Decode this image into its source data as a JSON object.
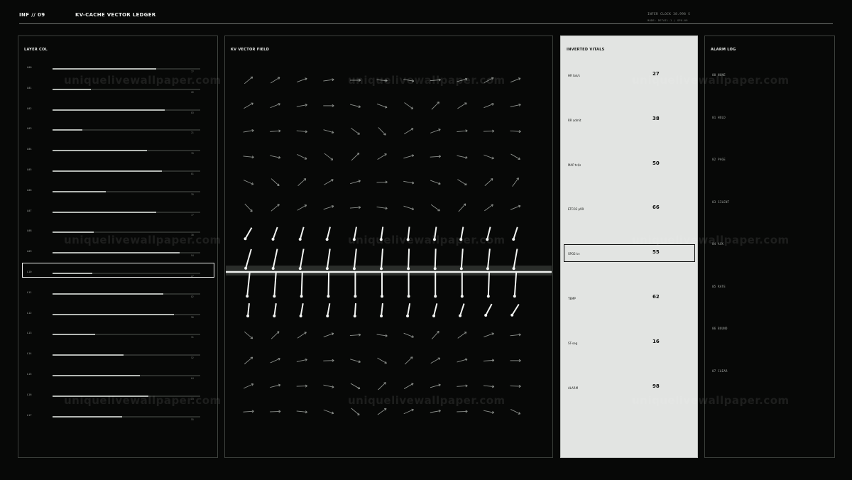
{
  "header": {
    "id": "INF // 09",
    "title": "KV-CACHE VECTOR LEDGER",
    "clock": "INFER CLOCK 38.998 S",
    "mode": "MODE: DETAIL-1 / GPU-09"
  },
  "layer_panel": {
    "title": "LAYER COL",
    "selected_index": 10,
    "rows": [
      {
        "name": "L00",
        "value": "77",
        "fill": 0.7
      },
      {
        "name": "L01",
        "value": "26",
        "fill": 0.26
      },
      {
        "name": "L02",
        "value": "83",
        "fill": 0.76
      },
      {
        "name": "L03",
        "value": "21",
        "fill": 0.2
      },
      {
        "name": "L04",
        "value": "70",
        "fill": 0.64
      },
      {
        "name": "L05",
        "value": "81",
        "fill": 0.74
      },
      {
        "name": "L06",
        "value": "39",
        "fill": 0.36
      },
      {
        "name": "L07",
        "value": "77",
        "fill": 0.7
      },
      {
        "name": "L08",
        "value": "30",
        "fill": 0.28
      },
      {
        "name": "L09",
        "value": "94",
        "fill": 0.86
      },
      {
        "name": "L10",
        "value": "27",
        "fill": 0.27
      },
      {
        "name": "L11",
        "value": "82",
        "fill": 0.75
      },
      {
        "name": "L12",
        "value": "90",
        "fill": 0.82
      },
      {
        "name": "L13",
        "value": "31",
        "fill": 0.29
      },
      {
        "name": "L14",
        "value": "52",
        "fill": 0.48
      },
      {
        "name": "L15",
        "value": "64",
        "fill": 0.59
      },
      {
        "name": "L16",
        "value": "73",
        "fill": 0.65
      },
      {
        "name": "L17",
        "value": "55",
        "fill": 0.47
      }
    ]
  },
  "field_panel": {
    "title": "KV VECTOR FIELD",
    "columns": 11,
    "rows": 14,
    "angles": [
      [
        -40,
        -32,
        -20,
        -8,
        0,
        5,
        10,
        -5,
        -15,
        -28,
        -22
      ],
      [
        -30,
        -22,
        -10,
        0,
        14,
        20,
        36,
        -45,
        -32,
        -22,
        -12
      ],
      [
        -10,
        -4,
        6,
        16,
        36,
        46,
        -32,
        -20,
        -6,
        -2,
        4
      ],
      [
        6,
        12,
        26,
        38,
        -44,
        -32,
        -16,
        -4,
        12,
        20,
        30
      ],
      [
        24,
        42,
        -42,
        -30,
        -16,
        -2,
        10,
        20,
        32,
        -42,
        -54
      ],
      [
        46,
        -40,
        -30,
        -18,
        -4,
        8,
        18,
        36,
        -48,
        -36,
        -22
      ],
      [
        -60,
        -70,
        -74,
        -76,
        -80,
        -82,
        -84,
        -82,
        -80,
        -76,
        -72
      ],
      [
        -74,
        -78,
        -80,
        -82,
        -84,
        -86,
        -88,
        -88,
        -86,
        -84,
        -80
      ],
      [
        -84,
        -86,
        -88,
        -89,
        -90,
        -90,
        -90,
        -90,
        -90,
        -88,
        -86
      ],
      [
        -84,
        -82,
        -80,
        -80,
        -86,
        -84,
        -80,
        -76,
        -72,
        -62,
        -58
      ],
      [
        40,
        -44,
        -34,
        -20,
        -4,
        8,
        22,
        -48,
        -36,
        -20,
        -6
      ],
      [
        -40,
        -24,
        -12,
        -2,
        16,
        30,
        -44,
        -30,
        -16,
        -4,
        0
      ],
      [
        -24,
        -14,
        -2,
        12,
        30,
        -44,
        -30,
        -16,
        -4,
        6,
        2
      ],
      [
        -4,
        -2,
        6,
        20,
        40,
        -36,
        -24,
        -10,
        -2,
        12,
        26
      ]
    ]
  },
  "vitals_panel": {
    "title": "INVERTED VITALS",
    "selected_index": 4,
    "rows": [
      {
        "label": "HR tok/s",
        "value": "27"
      },
      {
        "label": "RR admit",
        "value": "38"
      },
      {
        "label": "MAP tcl/s",
        "value": "50"
      },
      {
        "label": "ETCO2 p99",
        "value": "66"
      },
      {
        "label": "SPO2 kv",
        "value": "55"
      },
      {
        "label": "TEMP",
        "value": "62"
      },
      {
        "label": "ST-seg",
        "value": "16"
      },
      {
        "label": "ALARM",
        "value": "98"
      }
    ]
  },
  "alarm_panel": {
    "title": "ALARM LOG",
    "entries": [
      "00 NONE",
      "01 HOLD",
      "02 PAGE",
      "03 SILENT",
      "04 ACK",
      "05 RATE",
      "06 BOUND",
      "07 CLEAR"
    ]
  },
  "watermark": "uniquelivewallpaper.com",
  "colors": {
    "background": "#070807",
    "panel_border": "#3c403c",
    "bar_fill": "#b4b8b4",
    "inverted_panel_bg": "#e2e4e2",
    "highlight": "#eef0ee"
  }
}
